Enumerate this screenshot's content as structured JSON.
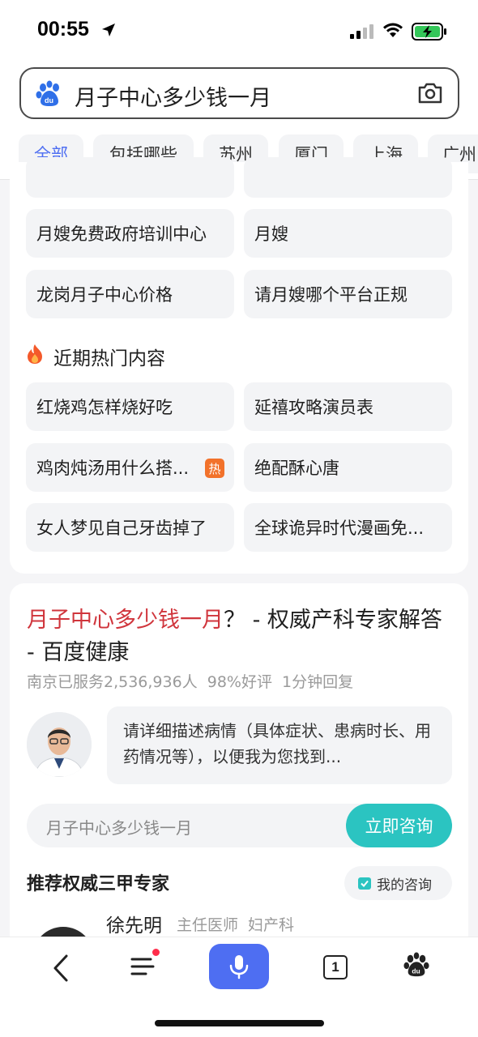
{
  "status": {
    "time": "00:55"
  },
  "search": {
    "query": "月子中心多少钱一月"
  },
  "tabs": [
    "全部",
    "包括哪些",
    "苏州",
    "厦门",
    "上海",
    "广州"
  ],
  "related_searches": [
    "月嫂免费政府培训中心",
    "月嫂",
    "龙岗月子中心价格",
    "请月嫂哪个平台正规"
  ],
  "hot_section": {
    "title": "近期热门内容",
    "items": [
      {
        "label": "红烧鸡怎样烧好吃",
        "badge": ""
      },
      {
        "label": "延禧攻略演员表",
        "badge": ""
      },
      {
        "label": "鸡肉炖汤用什么搭...",
        "badge": "热"
      },
      {
        "label": "绝配酥心唐",
        "badge": ""
      },
      {
        "label": "女人梦见自己牙齿掉了",
        "badge": ""
      },
      {
        "label": "全球诡异时代漫画免...",
        "badge": ""
      }
    ]
  },
  "result": {
    "title_highlight": "月子中心多少钱一月",
    "title_rest": "？ - 权威产科专家解答 - 百度健康",
    "meta": "南京已服务2,536,936人 98%好评 1分钟回复",
    "bubble": "请详细描述病情（具体症状、患病时长、用药情况等），以便我为您找到...",
    "ask_placeholder": "月子中心多少钱一月",
    "ask_button": "立即咨询",
    "recommend_title": "推荐权威三甲专家",
    "my_consult": "我的咨询",
    "doctor_name": "徐先明",
    "doctor_title": "主任医师 妇产科"
  },
  "bottom_nav": {
    "tabs_count": "1"
  },
  "colors": {
    "accent": "#4e6ef2",
    "highlight": "#d0353c",
    "consult": "#2bc4c1",
    "hot_badge": "#f2722b"
  }
}
